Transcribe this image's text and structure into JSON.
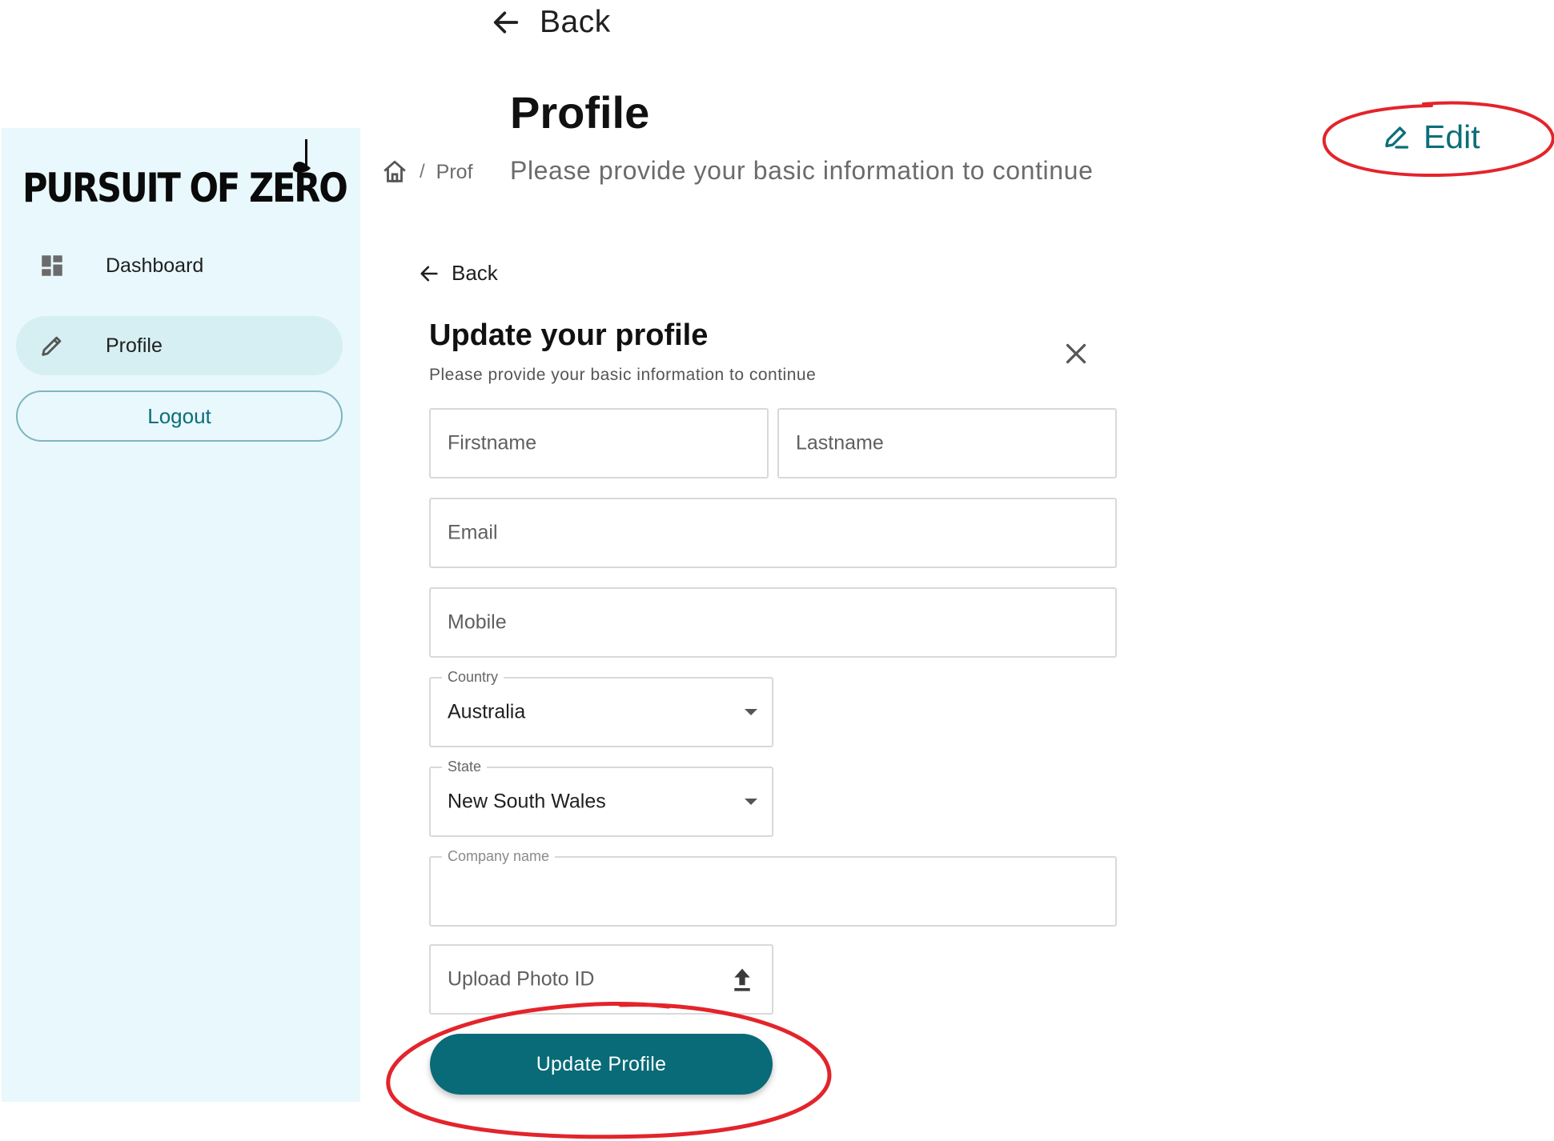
{
  "header": {
    "back_label": "Back",
    "title": "Profile",
    "subtitle": "Please provide your basic information to continue",
    "edit_label": "Edit"
  },
  "sidebar": {
    "logo_text": "PURSUIT OF ZERO",
    "items": [
      {
        "label": "Dashboard",
        "icon": "dashboard-icon"
      },
      {
        "label": "Profile",
        "icon": "pencil-icon",
        "active": true
      }
    ],
    "logout_label": "Logout"
  },
  "breadcrumb": {
    "home_icon": "home-icon",
    "separator": "/",
    "current": "Prof"
  },
  "form": {
    "back_label": "Back",
    "title": "Update your profile",
    "subtitle": "Please provide your basic information to continue",
    "fields": {
      "firstname": {
        "placeholder": "Firstname",
        "value": ""
      },
      "lastname": {
        "placeholder": "Lastname",
        "value": ""
      },
      "email": {
        "placeholder": "Email",
        "value": ""
      },
      "mobile": {
        "placeholder": "Mobile",
        "value": ""
      },
      "country": {
        "label": "Country",
        "value": "Australia"
      },
      "state": {
        "label": "State",
        "value": "New South Wales"
      },
      "company": {
        "label": "Company name",
        "value": ""
      },
      "upload": {
        "placeholder": "Upload Photo ID",
        "icon": "upload-icon"
      }
    },
    "submit_label": "Update Profile"
  },
  "colors": {
    "accent": "#086b77",
    "sidebar_bg": "#e8f8fd",
    "active_item_bg": "#d6eff3",
    "annotation_red": "#e3242b"
  }
}
